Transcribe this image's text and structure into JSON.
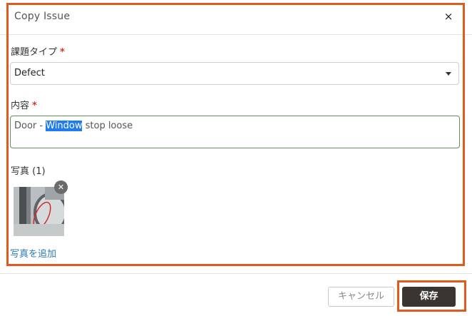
{
  "dialog": {
    "title": "Copy Issue",
    "close_icon": "×"
  },
  "form": {
    "type_label": "課題タイプ",
    "type_required": "*",
    "type_value": "Defect",
    "content_label": "内容",
    "content_required": "*",
    "content_before": "Door - ",
    "content_selected": "Window",
    "content_after": " stop loose",
    "photos_label": "写真 (1)",
    "remove_icon": "✕",
    "add_photo_label": "写真を追加"
  },
  "footer": {
    "cancel_label": "キャンセル",
    "save_label": "保存"
  },
  "colors": {
    "highlight": "#e05a1e",
    "save_button": "#3a3530",
    "link": "#2a7ab8",
    "required": "#d9362b",
    "selection": "#1f7cf0"
  }
}
